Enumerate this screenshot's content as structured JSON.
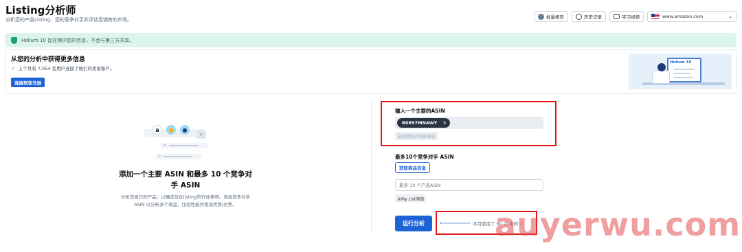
{
  "header": {
    "title": "Listing分析师",
    "subtitle": "分析您的产品Listing、您的竞争对手并评估您销售的市场。",
    "actions": {
      "bulk_report": "批量报告",
      "history": "历史记录",
      "tutorial": "学习视频",
      "marketplace": "www.amazon.com"
    }
  },
  "privacy": {
    "text": "Helium 10 旨在保护您的信息，不会与第三方共享。"
  },
  "info_card": {
    "title": "从您的分析中获得更多信息",
    "check_text": "上个月有 7,054 名用户连接了他们的卖家账户。",
    "connect_button": "连接到亚马逊",
    "promo_logo": "Helium 10"
  },
  "left_panel": {
    "heading": "添加一个主要 ASIN 和最多 10 个竞争对手 ASIN",
    "description": "分析您自己的产品，以确定优化listing的行动事项。添加竞争对手 ASIN 以分析多个商品、比较性能并发现优势/劣势。",
    "illustration_letter": "a"
  },
  "right_panel": {
    "main_asin_label": "输入一个主要的ASIN",
    "asin_chip": "B0897MN4WY",
    "chip_close": "×",
    "add_own_product": "选择我的产品来添加",
    "competitor_label": "最多10个竞争对手 ASIN",
    "get_info_button": "获取商品信息",
    "competitor_placeholder": "最多 10 个产品ASIN",
    "from_mylist": "从My List添加",
    "run_button": "运行分析",
    "usage_text": "本月使用了 60 次 中的 1",
    "usage_used": 1,
    "usage_total": 60
  },
  "watermark": "auyerwu.com",
  "colors": {
    "primary": "#1e63d6",
    "privacy_bg": "#dcf4ec",
    "highlight": "#e01818"
  }
}
